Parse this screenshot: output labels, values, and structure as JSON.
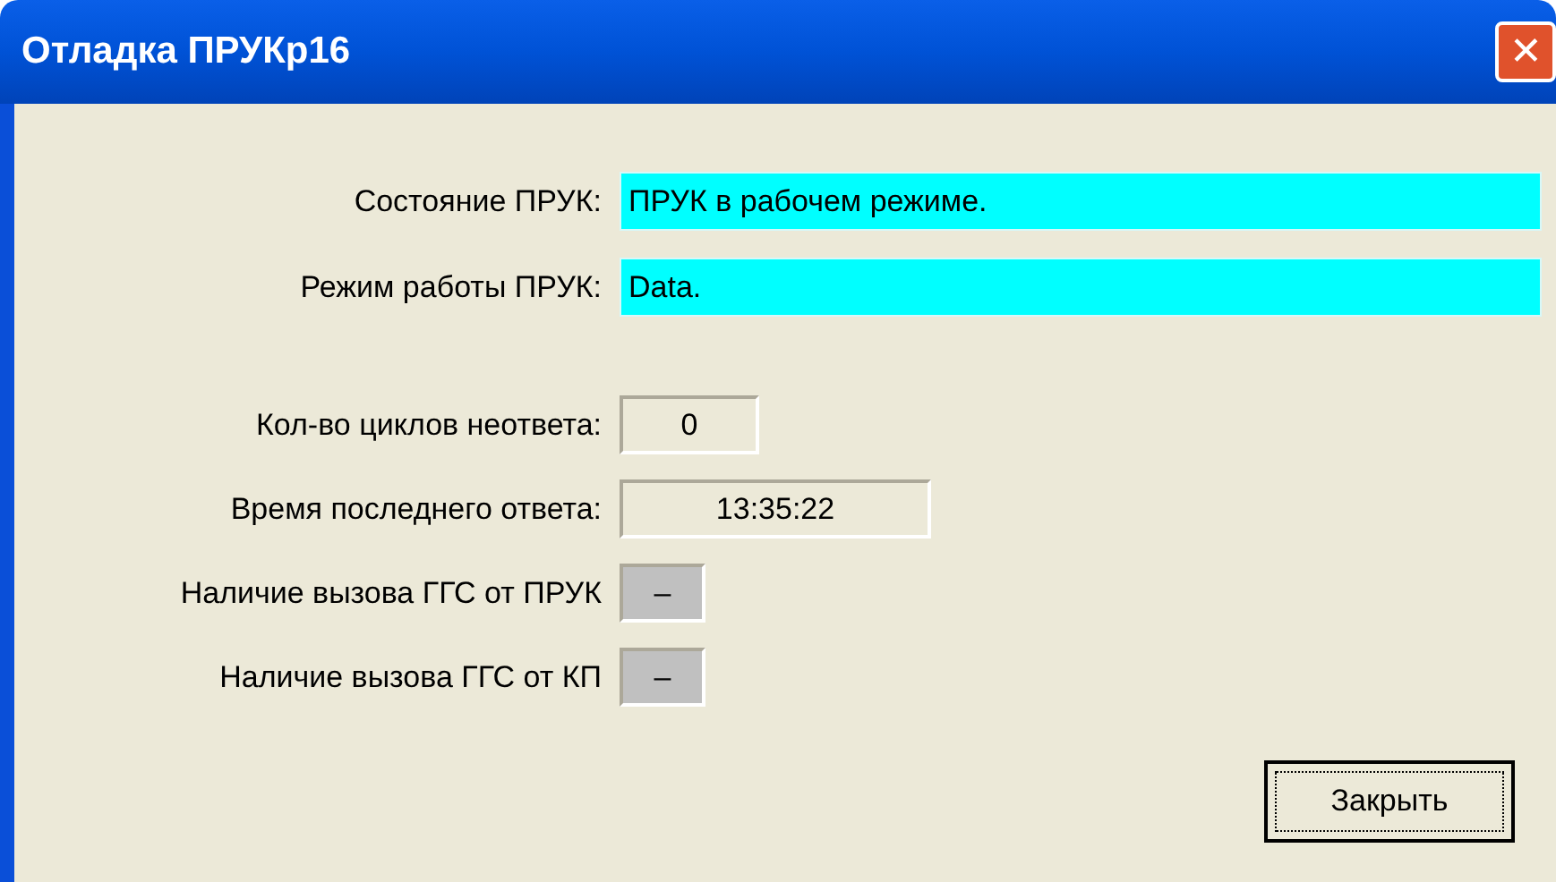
{
  "window": {
    "title": "Отладка ПРУКр16",
    "close_glyph": "✕"
  },
  "status_fields": [
    {
      "label": "Состояние ПРУК:",
      "value": "ПРУК в рабочем режиме.",
      "kind": "highlight"
    },
    {
      "label": "Режим работы ПРУК:",
      "value": "Data.",
      "kind": "highlight"
    }
  ],
  "info_fields": [
    {
      "label": "Кол-во циклов неответа:",
      "value": "0",
      "kind": "short"
    },
    {
      "label": "Время последнего ответа:",
      "value": "13:35:22",
      "kind": "wide"
    },
    {
      "label": "Наличие вызова ГГС от ПРУК",
      "value": "–",
      "kind": "indicator"
    },
    {
      "label": "Наличие вызова ГГС от КП",
      "value": "–",
      "kind": "indicator"
    }
  ],
  "buttons": [
    "Закрыть"
  ]
}
